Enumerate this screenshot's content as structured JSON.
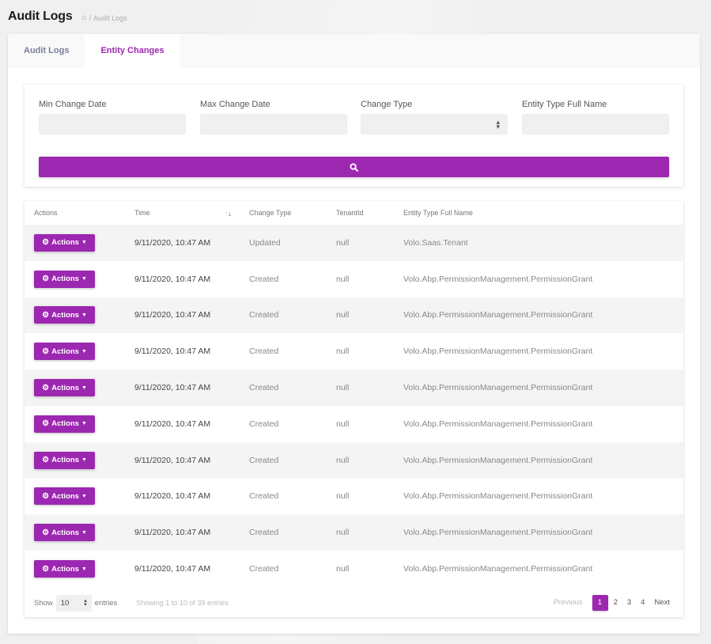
{
  "header": {
    "title": "Audit Logs",
    "breadcrumb": {
      "home_icon": "home-icon",
      "separator": "/",
      "current": "Audit Logs"
    }
  },
  "tabs": [
    {
      "label": "Audit Logs",
      "active": false
    },
    {
      "label": "Entity Changes",
      "active": true
    }
  ],
  "filters": {
    "min_change_date": {
      "label": "Min Change Date",
      "value": ""
    },
    "max_change_date": {
      "label": "Max Change Date",
      "value": ""
    },
    "change_type": {
      "label": "Change Type",
      "value": ""
    },
    "entity_type_full_name": {
      "label": "Entity Type Full Name",
      "value": ""
    },
    "search_icon": "search-icon"
  },
  "table": {
    "columns": [
      "Actions",
      "Time",
      "Change Type",
      "TenantId",
      "Entity Type Full Name"
    ],
    "action_label": "Actions",
    "rows": [
      {
        "time": "9/11/2020, 10:47 AM",
        "change_type": "Updated",
        "tenant_id": "null",
        "entity_type": "Volo.Saas.Tenant"
      },
      {
        "time": "9/11/2020, 10:47 AM",
        "change_type": "Created",
        "tenant_id": "null",
        "entity_type": "Volo.Abp.PermissionManagement.PermissionGrant"
      },
      {
        "time": "9/11/2020, 10:47 AM",
        "change_type": "Created",
        "tenant_id": "null",
        "entity_type": "Volo.Abp.PermissionManagement.PermissionGrant"
      },
      {
        "time": "9/11/2020, 10:47 AM",
        "change_type": "Created",
        "tenant_id": "null",
        "entity_type": "Volo.Abp.PermissionManagement.PermissionGrant"
      },
      {
        "time": "9/11/2020, 10:47 AM",
        "change_type": "Created",
        "tenant_id": "null",
        "entity_type": "Volo.Abp.PermissionManagement.PermissionGrant"
      },
      {
        "time": "9/11/2020, 10:47 AM",
        "change_type": "Created",
        "tenant_id": "null",
        "entity_type": "Volo.Abp.PermissionManagement.PermissionGrant"
      },
      {
        "time": "9/11/2020, 10:47 AM",
        "change_type": "Created",
        "tenant_id": "null",
        "entity_type": "Volo.Abp.PermissionManagement.PermissionGrant"
      },
      {
        "time": "9/11/2020, 10:47 AM",
        "change_type": "Created",
        "tenant_id": "null",
        "entity_type": "Volo.Abp.PermissionManagement.PermissionGrant"
      },
      {
        "time": "9/11/2020, 10:47 AM",
        "change_type": "Created",
        "tenant_id": "null",
        "entity_type": "Volo.Abp.PermissionManagement.PermissionGrant"
      },
      {
        "time": "9/11/2020, 10:47 AM",
        "change_type": "Created",
        "tenant_id": "null",
        "entity_type": "Volo.Abp.PermissionManagement.PermissionGrant"
      }
    ]
  },
  "footer": {
    "show_label": "Show",
    "page_length": "10",
    "entries_label": "entries",
    "info": "Showing 1 to 10 of 39 entries",
    "pagination": {
      "previous": "Previous",
      "pages": [
        "1",
        "2",
        "3",
        "4"
      ],
      "current": "1",
      "next": "Next"
    }
  },
  "colors": {
    "accent": "#9c27b0",
    "background": "#f0f0f0"
  }
}
